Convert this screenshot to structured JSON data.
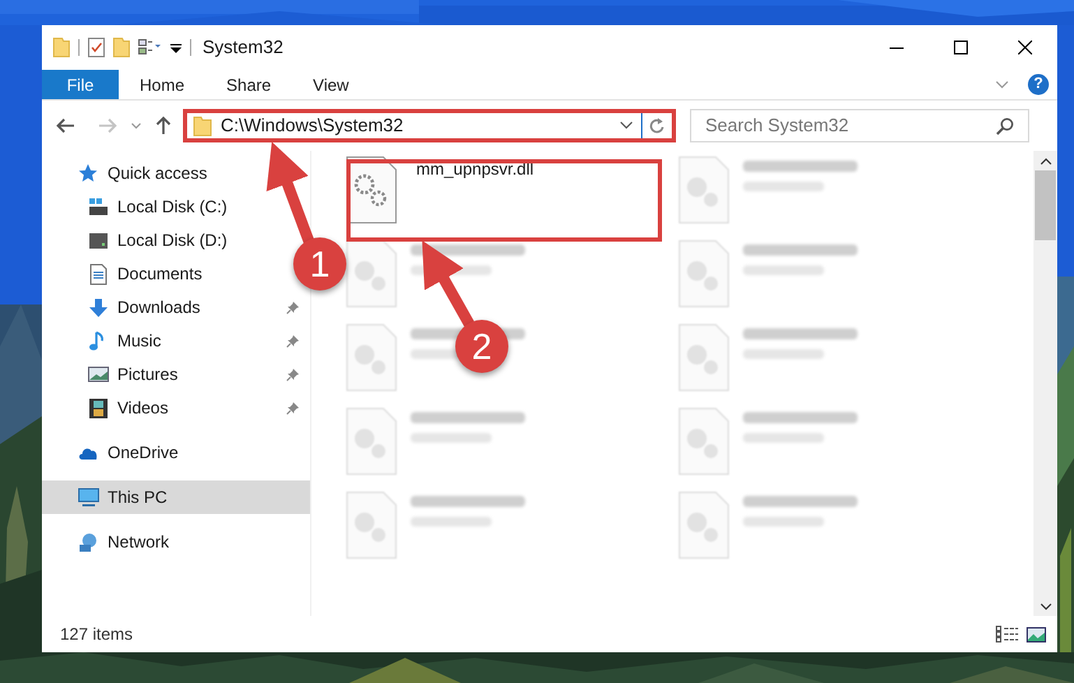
{
  "window": {
    "title": "System32"
  },
  "ribbon": {
    "tabs": [
      {
        "label": "File",
        "selected": true
      },
      {
        "label": "Home",
        "selected": false
      },
      {
        "label": "Share",
        "selected": false
      },
      {
        "label": "View",
        "selected": false
      }
    ],
    "help": "?"
  },
  "address_bar": {
    "path": "C:\\Windows\\System32"
  },
  "search": {
    "placeholder": "Search System32"
  },
  "nav_pane": [
    {
      "label": "Quick access",
      "selected": false,
      "children": [
        {
          "label": "Local Disk (C:)",
          "pinned": false
        },
        {
          "label": "Local Disk (D:)",
          "pinned": false
        },
        {
          "label": "Documents",
          "pinned": false
        },
        {
          "label": "Downloads",
          "pinned": true
        },
        {
          "label": "Music",
          "pinned": true
        },
        {
          "label": "Pictures",
          "pinned": true
        },
        {
          "label": "Videos",
          "pinned": true
        }
      ]
    },
    {
      "label": "OneDrive",
      "selected": false
    },
    {
      "label": "This PC",
      "selected": true
    },
    {
      "label": "Network",
      "selected": false
    }
  ],
  "files": [
    {
      "kind": "file",
      "name": "mm_upnpsvr.dll"
    },
    {
      "kind": "blurred"
    },
    {
      "kind": "blurred"
    },
    {
      "kind": "blurred"
    },
    {
      "kind": "blurred"
    },
    {
      "kind": "blurred"
    },
    {
      "kind": "blurred"
    },
    {
      "kind": "blurred"
    },
    {
      "kind": "blurred"
    },
    {
      "kind": "blurred"
    }
  ],
  "status_bar": {
    "item_count": "127 items"
  },
  "annotations": [
    {
      "label": "1"
    },
    {
      "label": "2"
    }
  ]
}
